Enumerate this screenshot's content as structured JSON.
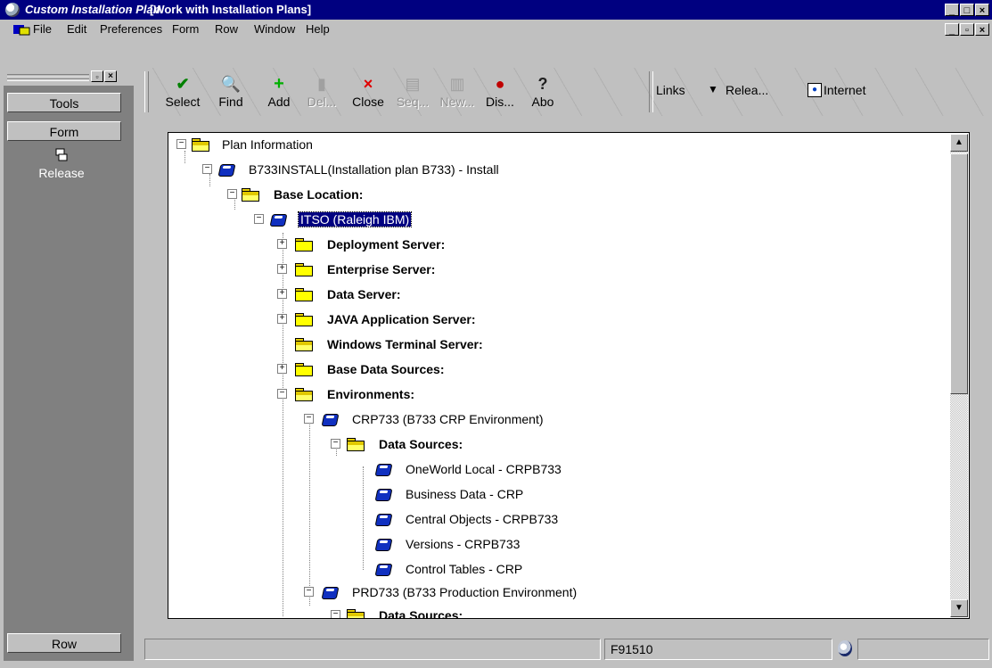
{
  "window": {
    "app_title": "Custom Installation Plan",
    "separator": " - ",
    "doc_title": "[Work with Installation Plans]"
  },
  "menu": [
    {
      "label": "File",
      "name": "menu-file"
    },
    {
      "label": "Edit",
      "name": "menu-edit"
    },
    {
      "label": "Preferences",
      "name": "menu-preferences"
    },
    {
      "label": "Form",
      "name": "menu-form"
    },
    {
      "label": "Row",
      "name": "menu-row"
    },
    {
      "label": "Window",
      "name": "menu-window"
    },
    {
      "label": "Help",
      "name": "menu-help"
    }
  ],
  "left_panel": {
    "tools": "Tools",
    "form": "Form",
    "release": "Release",
    "row": "Row"
  },
  "toolbar": {
    "select": "Select",
    "find": "Find",
    "add": "Add",
    "delete": "Del...",
    "close": "Close",
    "seq": "Seq...",
    "new": "New...",
    "display": "Dis...",
    "about": "Abo",
    "links": "Links",
    "release": "Relea...",
    "internet": "Internet"
  },
  "tree": {
    "plan_info": "Plan Information",
    "plan": "B733INSTALL(Installation plan B733) - Install",
    "base_location": "Base Location:",
    "itso": "ITSO (Raleigh IBM)",
    "deployment": "Deployment Server:",
    "enterprise": "Enterprise Server:",
    "data_server": "Data Server:",
    "java": "JAVA Application Server:",
    "wts": "Windows Terminal Server:",
    "base_ds": "Base Data Sources:",
    "environments": "Environments:",
    "crp": "CRP733 (B733 CRP Environment)",
    "crp_ds": "Data Sources:",
    "ds1": "OneWorld Local - CRPB733",
    "ds2": "Business Data - CRP",
    "ds3": "Central Objects - CRPB733",
    "ds4": "Versions - CRPB733",
    "ds5": "Control Tables - CRP",
    "prd": "PRD733 (B733 Production Environment)",
    "prd_ds": "Data Sources:"
  },
  "status": {
    "form_id": "F91510"
  },
  "colors": {
    "title_bg": "#000080",
    "panel_bg": "#808080",
    "face": "#c0c0c0"
  }
}
